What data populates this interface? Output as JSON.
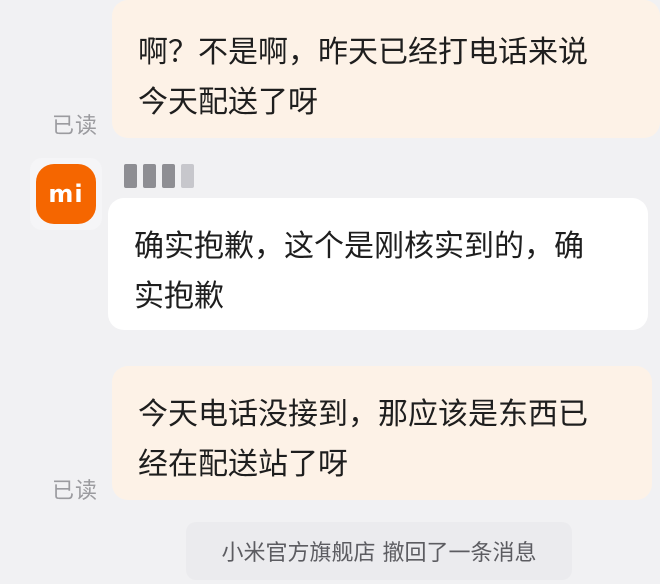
{
  "messages": [
    {
      "direction": "outgoing",
      "lines": [
        "啊？不是啊，昨天已经打电话来说",
        "今天配送了呀"
      ],
      "status": "已读"
    },
    {
      "direction": "incoming",
      "sender_logo": "mi",
      "lines": [
        "确实抱歉，这个是刚核实到的，确",
        "实抱歉"
      ]
    },
    {
      "direction": "outgoing",
      "lines": [
        "今天电话没接到，那应该是东西已",
        "经在配送站了呀"
      ],
      "status": "已读"
    }
  ],
  "system_notice": "小米官方旗舰店 撤回了一条消息",
  "colors": {
    "outgoing_bubble": "#fdf2e7",
    "incoming_bubble": "#ffffff",
    "brand_orange": "#f56600",
    "background": "#f1f1f3"
  },
  "icons": {
    "avatar": "xiaomi-logo-icon"
  }
}
